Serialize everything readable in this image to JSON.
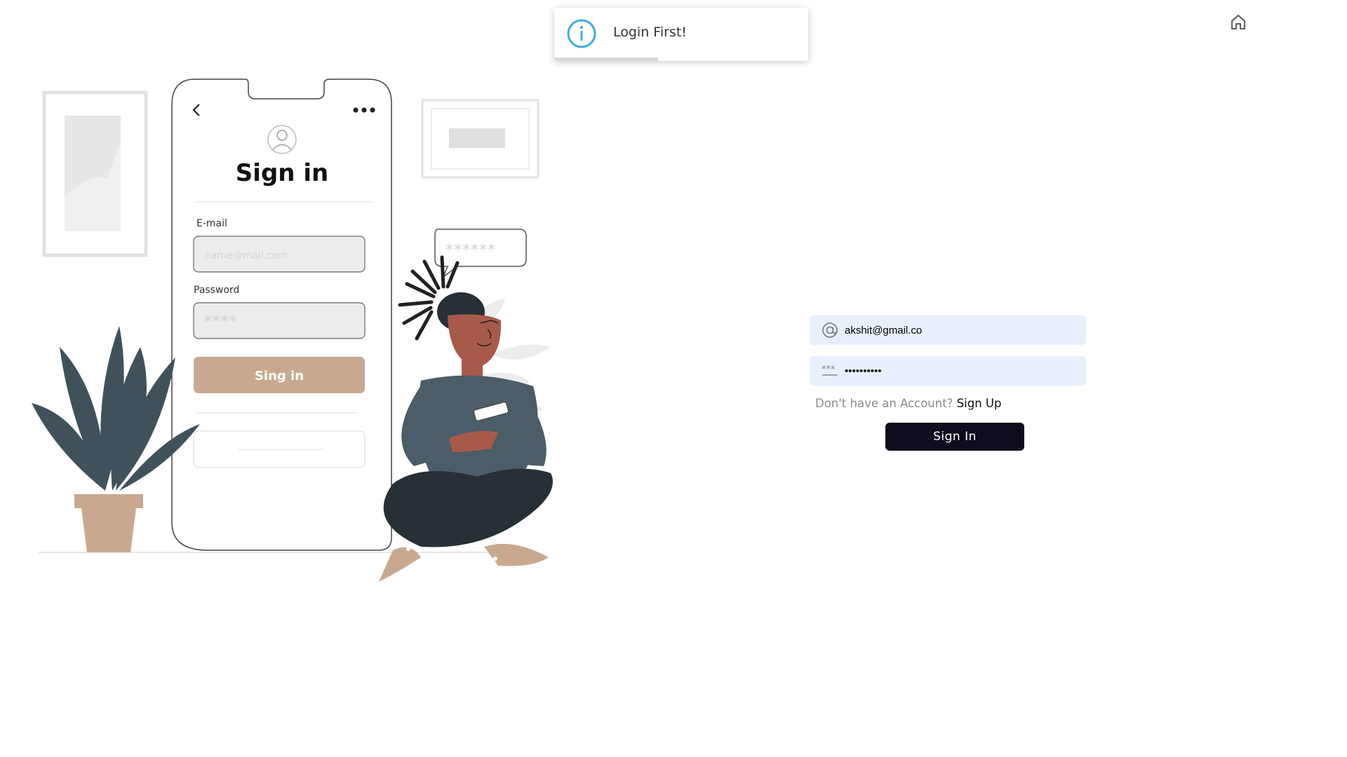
{
  "toast": {
    "message": "Login First!",
    "progress": 0.41,
    "accent": "#3dafd8"
  },
  "nav": {
    "home_icon": "home-icon"
  },
  "illustration": {
    "title": "Sign in",
    "email_label": "E-mail",
    "email_placeholder": "name@mail.com",
    "password_label": "Password",
    "password_mask": "****",
    "button_label": "Sing in",
    "bubble_text": "******",
    "colors": {
      "plant": "#3f525c",
      "pot": "#c8a98f",
      "skin": "#a85a4a",
      "shirt": "#4a5d68",
      "pants": "#263035"
    }
  },
  "form": {
    "email_value": "akshit@gmail.co",
    "password_value": "••••••••••",
    "signup_prompt": "Don't have an Account?",
    "signup_link": "Sign Up",
    "signin_label": "Sign In",
    "field_bg": "#e8f0fe",
    "button_bg": "#0e0c1d"
  }
}
